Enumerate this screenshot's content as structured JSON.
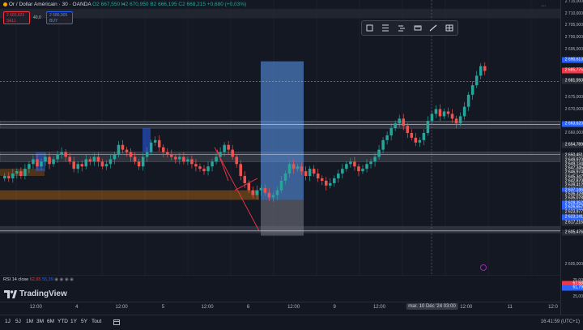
{
  "header": {
    "symbol": "Or / Dollar Américain · 30 · OANDA",
    "ohlc": "O2 667,550  H2 670,950  B2 666,195  C2 668,215  +0,680 (+0,03%)"
  },
  "trade": {
    "sell_price": "2 683,825",
    "sell_label": "SELL",
    "spread": "40,0",
    "buy_price": "2 686,005",
    "buy_label": "BUY"
  },
  "price_axis": [
    {
      "label": "2 715,000",
      "v": 2715
    },
    {
      "label": "2 710,000",
      "v": 2710
    },
    {
      "label": "2 705,000",
      "v": 2705
    },
    {
      "label": "2 700,000",
      "v": 2700
    },
    {
      "label": "2 695,000",
      "v": 2695
    },
    {
      "label": "2 675,000",
      "v": 2675
    },
    {
      "label": "2 670,000",
      "v": 2670
    },
    {
      "label": "2 660,000",
      "v": 2660
    },
    {
      "label": "2 655,000",
      "v": 2655
    },
    {
      "label": "2 640,000",
      "v": 2640
    },
    {
      "label": "2 605,000",
      "v": 2605
    }
  ],
  "price_tags": [
    {
      "label": "2 690,613",
      "v": 2690.6,
      "color": "#2962ff"
    },
    {
      "label": "2 685,775",
      "v": 2686.0,
      "color": "#f23645"
    },
    {
      "label": "2 681,593",
      "v": 2681.6,
      "color": "#2a2e39"
    },
    {
      "label": "2 663,620",
      "v": 2663.6,
      "color": "#2962ff"
    },
    {
      "label": "2 654,789",
      "v": 2654.8,
      "color": "#2a2e39"
    },
    {
      "label": "2 650,451",
      "v": 2650.4,
      "color": "#2a2e39"
    },
    {
      "label": "2 649,970",
      "v": 2648.6,
      "color": "#2a2e39"
    },
    {
      "label": "2 649,134",
      "v": 2646.8,
      "color": "#2a2e39"
    },
    {
      "label": "2 647,345",
      "v": 2645.0,
      "color": "#2a2e39"
    },
    {
      "label": "2 646,974",
      "v": 2643.2,
      "color": "#2a2e39"
    },
    {
      "label": "2 645,347",
      "v": 2641.4,
      "color": "#2a2e39"
    },
    {
      "label": "2 642,870",
      "v": 2639.6,
      "color": "#2a2e39"
    },
    {
      "label": "2 639,412",
      "v": 2637.8,
      "color": "#2a2e39"
    },
    {
      "label": "2 637,146",
      "v": 2636.0,
      "color": "#2962ff"
    },
    {
      "label": "2 636,328",
      "v": 2634.2,
      "color": "#2a2e39"
    },
    {
      "label": "2 635,078",
      "v": 2632.4,
      "color": "#2a2e39"
    },
    {
      "label": "2 628,352",
      "v": 2630.6,
      "color": "#2962ff"
    },
    {
      "label": "2 626,657",
      "v": 2628.8,
      "color": "#2962ff"
    },
    {
      "label": "2 623,977",
      "v": 2626.8,
      "color": "#2a2e39"
    },
    {
      "label": "2 623,141",
      "v": 2624.6,
      "color": "#2962ff"
    },
    {
      "label": "2 617,216",
      "v": 2622.2,
      "color": "#2a2e39"
    },
    {
      "label": "2 605,476",
      "v": 2618.4,
      "color": "#2a2e39"
    }
  ],
  "rsi": {
    "title": "RSI 14 close",
    "value_red": "62,65",
    "value_blue": "55,39",
    "marks": [
      {
        "label": "75,00",
        "pos": 0.1
      },
      {
        "label": "67,58",
        "pos": 0.25,
        "color": "#f23645"
      },
      {
        "label": "61,79",
        "pos": 0.45,
        "color": "#2962ff"
      },
      {
        "label": "25,00",
        "pos": 0.9
      }
    ]
  },
  "time_axis": [
    {
      "label": "12:00",
      "pos": 0.064
    },
    {
      "label": "4",
      "pos": 0.137
    },
    {
      "label": "12:00",
      "pos": 0.217
    },
    {
      "label": "5",
      "pos": 0.291
    },
    {
      "label": "12:00",
      "pos": 0.37
    },
    {
      "label": "6",
      "pos": 0.443
    },
    {
      "label": "12:00",
      "pos": 0.524
    },
    {
      "label": "9",
      "pos": 0.597
    },
    {
      "label": "12:00",
      "pos": 0.677
    },
    {
      "label": "mar. 10 Déc '24  03:00",
      "pos": 0.771,
      "highlight": true
    },
    {
      "label": "12:00",
      "pos": 0.832
    },
    {
      "label": "11",
      "pos": 0.91
    },
    {
      "label": "12:0",
      "pos": 0.987
    }
  ],
  "ranges": [
    "1J",
    "5J",
    "1M",
    "3M",
    "6M",
    "YTD",
    "1Y",
    "5Y",
    "Tout"
  ],
  "clock": "16:41:59 (UTC+1)",
  "logo": "TradingView",
  "tools": [
    "rectangle-icon",
    "fib-icon",
    "align-icon",
    "ruler-icon",
    "brush-icon",
    "grid-icon"
  ],
  "chart_data": {
    "type": "candlestick",
    "symbol": "XAU/USD",
    "timeframe": "30",
    "ylim": [
      2605,
      2715
    ],
    "candles_close": [
      2642,
      2641,
      2643,
      2644,
      2642,
      2645,
      2647,
      2649,
      2646,
      2648,
      2650,
      2647,
      2649,
      2651,
      2652,
      2650,
      2648,
      2645,
      2647,
      2646,
      2649,
      2648,
      2650,
      2648,
      2646,
      2647,
      2649,
      2651,
      2655,
      2653,
      2652,
      2650,
      2648,
      2646,
      2650,
      2652,
      2656,
      2657,
      2654,
      2652,
      2651,
      2650,
      2649,
      2650,
      2648,
      2649,
      2647,
      2646,
      2645,
      2644,
      2646,
      2648,
      2650,
      2652,
      2655,
      2653,
      2650,
      2647,
      2642,
      2639,
      2636,
      2634,
      2636,
      2637,
      2635,
      2633,
      2634,
      2636,
      2640,
      2643,
      2647,
      2645,
      2646,
      2644,
      2642,
      2645,
      2643,
      2641,
      2640,
      2638,
      2639,
      2641,
      2643,
      2645,
      2647,
      2648,
      2646,
      2644,
      2645,
      2647,
      2648,
      2650,
      2653,
      2657,
      2659,
      2662,
      2664,
      2666,
      2663,
      2660,
      2658,
      2656,
      2657,
      2660,
      2665,
      2668,
      2670,
      2667,
      2669,
      2668,
      2666,
      2664,
      2667,
      2671,
      2676,
      2680,
      2684,
      2688,
      2686
    ]
  }
}
